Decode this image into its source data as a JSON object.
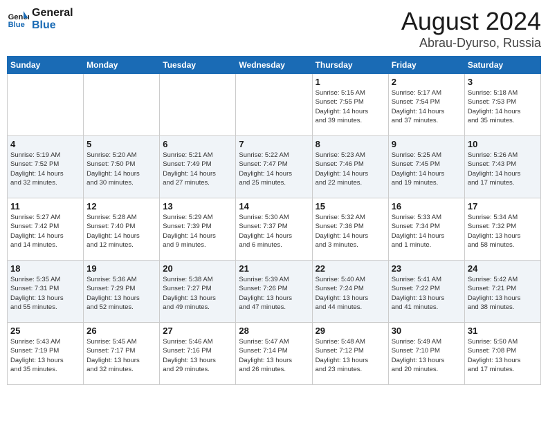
{
  "header": {
    "logo_general": "General",
    "logo_blue": "Blue",
    "month_year": "August 2024",
    "location": "Abrau-Dyurso, Russia"
  },
  "weekdays": [
    "Sunday",
    "Monday",
    "Tuesday",
    "Wednesday",
    "Thursday",
    "Friday",
    "Saturday"
  ],
  "weeks": [
    [
      {
        "day": "",
        "info": ""
      },
      {
        "day": "",
        "info": ""
      },
      {
        "day": "",
        "info": ""
      },
      {
        "day": "",
        "info": ""
      },
      {
        "day": "1",
        "info": "Sunrise: 5:15 AM\nSunset: 7:55 PM\nDaylight: 14 hours\nand 39 minutes."
      },
      {
        "day": "2",
        "info": "Sunrise: 5:17 AM\nSunset: 7:54 PM\nDaylight: 14 hours\nand 37 minutes."
      },
      {
        "day": "3",
        "info": "Sunrise: 5:18 AM\nSunset: 7:53 PM\nDaylight: 14 hours\nand 35 minutes."
      }
    ],
    [
      {
        "day": "4",
        "info": "Sunrise: 5:19 AM\nSunset: 7:52 PM\nDaylight: 14 hours\nand 32 minutes."
      },
      {
        "day": "5",
        "info": "Sunrise: 5:20 AM\nSunset: 7:50 PM\nDaylight: 14 hours\nand 30 minutes."
      },
      {
        "day": "6",
        "info": "Sunrise: 5:21 AM\nSunset: 7:49 PM\nDaylight: 14 hours\nand 27 minutes."
      },
      {
        "day": "7",
        "info": "Sunrise: 5:22 AM\nSunset: 7:47 PM\nDaylight: 14 hours\nand 25 minutes."
      },
      {
        "day": "8",
        "info": "Sunrise: 5:23 AM\nSunset: 7:46 PM\nDaylight: 14 hours\nand 22 minutes."
      },
      {
        "day": "9",
        "info": "Sunrise: 5:25 AM\nSunset: 7:45 PM\nDaylight: 14 hours\nand 19 minutes."
      },
      {
        "day": "10",
        "info": "Sunrise: 5:26 AM\nSunset: 7:43 PM\nDaylight: 14 hours\nand 17 minutes."
      }
    ],
    [
      {
        "day": "11",
        "info": "Sunrise: 5:27 AM\nSunset: 7:42 PM\nDaylight: 14 hours\nand 14 minutes."
      },
      {
        "day": "12",
        "info": "Sunrise: 5:28 AM\nSunset: 7:40 PM\nDaylight: 14 hours\nand 12 minutes."
      },
      {
        "day": "13",
        "info": "Sunrise: 5:29 AM\nSunset: 7:39 PM\nDaylight: 14 hours\nand 9 minutes."
      },
      {
        "day": "14",
        "info": "Sunrise: 5:30 AM\nSunset: 7:37 PM\nDaylight: 14 hours\nand 6 minutes."
      },
      {
        "day": "15",
        "info": "Sunrise: 5:32 AM\nSunset: 7:36 PM\nDaylight: 14 hours\nand 3 minutes."
      },
      {
        "day": "16",
        "info": "Sunrise: 5:33 AM\nSunset: 7:34 PM\nDaylight: 14 hours\nand 1 minute."
      },
      {
        "day": "17",
        "info": "Sunrise: 5:34 AM\nSunset: 7:32 PM\nDaylight: 13 hours\nand 58 minutes."
      }
    ],
    [
      {
        "day": "18",
        "info": "Sunrise: 5:35 AM\nSunset: 7:31 PM\nDaylight: 13 hours\nand 55 minutes."
      },
      {
        "day": "19",
        "info": "Sunrise: 5:36 AM\nSunset: 7:29 PM\nDaylight: 13 hours\nand 52 minutes."
      },
      {
        "day": "20",
        "info": "Sunrise: 5:38 AM\nSunset: 7:27 PM\nDaylight: 13 hours\nand 49 minutes."
      },
      {
        "day": "21",
        "info": "Sunrise: 5:39 AM\nSunset: 7:26 PM\nDaylight: 13 hours\nand 47 minutes."
      },
      {
        "day": "22",
        "info": "Sunrise: 5:40 AM\nSunset: 7:24 PM\nDaylight: 13 hours\nand 44 minutes."
      },
      {
        "day": "23",
        "info": "Sunrise: 5:41 AM\nSunset: 7:22 PM\nDaylight: 13 hours\nand 41 minutes."
      },
      {
        "day": "24",
        "info": "Sunrise: 5:42 AM\nSunset: 7:21 PM\nDaylight: 13 hours\nand 38 minutes."
      }
    ],
    [
      {
        "day": "25",
        "info": "Sunrise: 5:43 AM\nSunset: 7:19 PM\nDaylight: 13 hours\nand 35 minutes."
      },
      {
        "day": "26",
        "info": "Sunrise: 5:45 AM\nSunset: 7:17 PM\nDaylight: 13 hours\nand 32 minutes."
      },
      {
        "day": "27",
        "info": "Sunrise: 5:46 AM\nSunset: 7:16 PM\nDaylight: 13 hours\nand 29 minutes."
      },
      {
        "day": "28",
        "info": "Sunrise: 5:47 AM\nSunset: 7:14 PM\nDaylight: 13 hours\nand 26 minutes."
      },
      {
        "day": "29",
        "info": "Sunrise: 5:48 AM\nSunset: 7:12 PM\nDaylight: 13 hours\nand 23 minutes."
      },
      {
        "day": "30",
        "info": "Sunrise: 5:49 AM\nSunset: 7:10 PM\nDaylight: 13 hours\nand 20 minutes."
      },
      {
        "day": "31",
        "info": "Sunrise: 5:50 AM\nSunset: 7:08 PM\nDaylight: 13 hours\nand 17 minutes."
      }
    ]
  ]
}
